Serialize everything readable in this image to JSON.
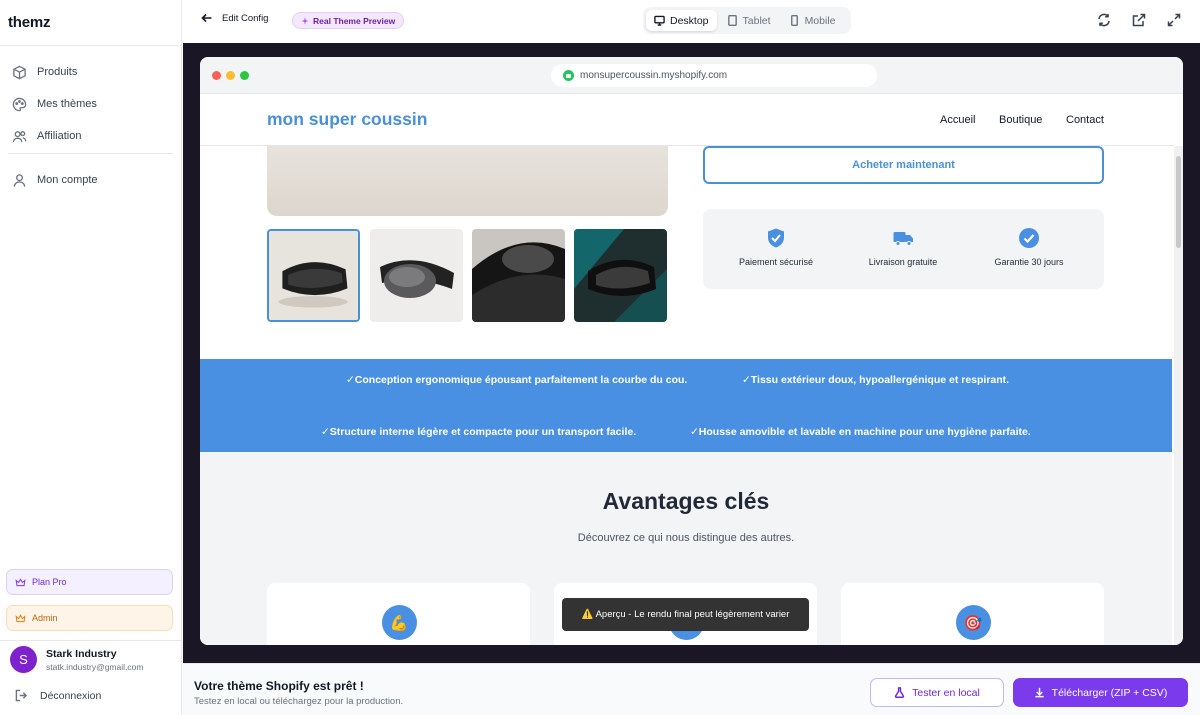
{
  "app": {
    "logo": "themz"
  },
  "sidebar": {
    "items": [
      {
        "label": "Produits",
        "icon": "box-icon"
      },
      {
        "label": "Mes thèmes",
        "icon": "palette-icon"
      },
      {
        "label": "Affiliation",
        "icon": "users-icon"
      },
      {
        "label": "Mon compte",
        "icon": "user-icon"
      }
    ],
    "plan_label": "Plan Pro",
    "admin_label": "Admin",
    "user": {
      "initial": "S",
      "name": "Stark Industry",
      "email": "statk.industry@gmail.com"
    },
    "logout_label": "Déconnexion"
  },
  "topbar": {
    "back_label": "Edit Config",
    "preview_label": "Real Theme Preview",
    "devices": [
      "Desktop",
      "Tablet",
      "Mobile"
    ],
    "active_device": "Desktop"
  },
  "browser": {
    "url": "monsupercoussin.myshopify.com"
  },
  "site": {
    "brand": "mon super coussin",
    "nav": [
      "Accueil",
      "Boutique",
      "Contact"
    ],
    "buy_label": "Acheter maintenant",
    "trust": [
      "Paiement sécurisé",
      "Livraison gratuite",
      "Garantie 30 jours"
    ],
    "benefits": [
      "✓Conception ergonomique épousant parfaitement la courbe du cou.",
      "✓Tissu extérieur doux, hypoallergénique et respirant.",
      "✓Structure interne légère et compacte pour un transport facile.",
      "✓Housse amovible et lavable en machine pour une hygiène parfaite."
    ],
    "advantages_title": "Avantages clés",
    "advantages_subtitle": "Découvrez ce qui nous distingue des autres.",
    "card_icons": [
      "💪",
      "",
      "🎯"
    ],
    "toast": "⚠️ Aperçu - Le rendu final peut légèrement varier"
  },
  "footer": {
    "title": "Votre thème Shopify est prêt !",
    "subtitle": "Testez en local ou téléchargez pour la production.",
    "test_label": "Tester en local",
    "download_label": "Télécharger (ZIP + CSV)"
  },
  "colors": {
    "accent": "#7c3aed",
    "store_blue": "#4a90e2",
    "stage_bg": "#1a1625"
  }
}
